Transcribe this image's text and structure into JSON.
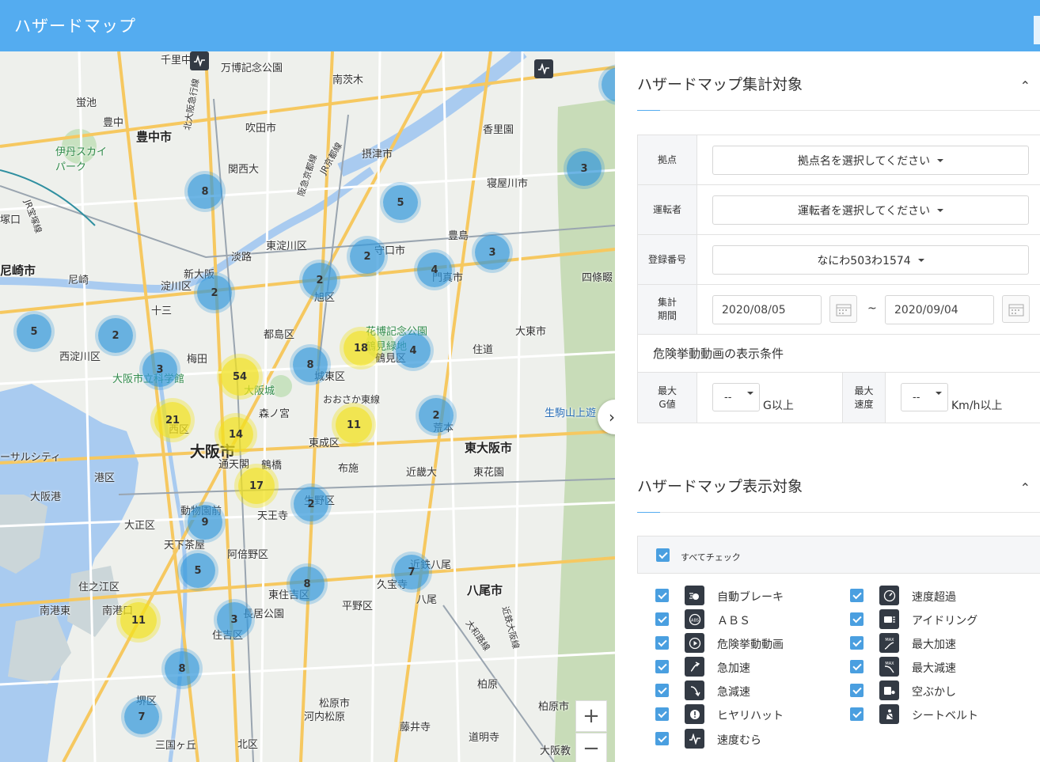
{
  "header": {
    "title": "ハザードマップ"
  },
  "map": {
    "labels": [
      {
        "text": "千里中央",
        "cls": ""
      },
      {
        "text": "万博記念公園",
        "cls": ""
      },
      {
        "text": "南茨木",
        "cls": ""
      },
      {
        "text": "蛍池",
        "cls": ""
      },
      {
        "text": "豊中",
        "cls": ""
      },
      {
        "text": "豊中市",
        "cls": "big"
      },
      {
        "text": "吹田市",
        "cls": ""
      },
      {
        "text": "香里園",
        "cls": ""
      },
      {
        "text": "伊丹スカイパーク",
        "cls": "green"
      },
      {
        "text": "関西大",
        "cls": ""
      },
      {
        "text": "摂津市",
        "cls": ""
      },
      {
        "text": "寝屋川市",
        "cls": ""
      },
      {
        "text": "尼崎市",
        "cls": "big"
      },
      {
        "text": "新大阪",
        "cls": ""
      },
      {
        "text": "淀川区",
        "cls": ""
      },
      {
        "text": "東淀川区",
        "cls": ""
      },
      {
        "text": "淡路",
        "cls": ""
      },
      {
        "text": "守口市",
        "cls": ""
      },
      {
        "text": "豊島",
        "cls": ""
      },
      {
        "text": "門真市",
        "cls": ""
      },
      {
        "text": "四條畷",
        "cls": ""
      },
      {
        "text": "尼崎",
        "cls": ""
      },
      {
        "text": "十三",
        "cls": ""
      },
      {
        "text": "旭区",
        "cls": ""
      },
      {
        "text": "都島区",
        "cls": ""
      },
      {
        "text": "大東市",
        "cls": ""
      },
      {
        "text": "西淀川区",
        "cls": ""
      },
      {
        "text": "梅田",
        "cls": ""
      },
      {
        "text": "花博記念公園 鶴見緑地",
        "cls": "green"
      },
      {
        "text": "住道",
        "cls": ""
      },
      {
        "text": "大阪市立科学館",
        "cls": "green"
      },
      {
        "text": "大阪城",
        "cls": "green"
      },
      {
        "text": "城東区",
        "cls": ""
      },
      {
        "text": "鶴見区",
        "cls": ""
      },
      {
        "text": "おおさか東線",
        "cls": ""
      },
      {
        "text": "生駒山上遊",
        "cls": "blue"
      },
      {
        "text": "西区",
        "cls": ""
      },
      {
        "text": "森ノ宮",
        "cls": ""
      },
      {
        "text": "荒本",
        "cls": ""
      },
      {
        "text": "大阪市",
        "cls": "huge"
      },
      {
        "text": "東成区",
        "cls": ""
      },
      {
        "text": "東大阪市",
        "cls": "big"
      },
      {
        "text": "ーサルシティ",
        "cls": ""
      },
      {
        "text": "通天閣",
        "cls": ""
      },
      {
        "text": "鶴橋",
        "cls": ""
      },
      {
        "text": "布施",
        "cls": ""
      },
      {
        "text": "港区",
        "cls": ""
      },
      {
        "text": "近畿大",
        "cls": ""
      },
      {
        "text": "東花園",
        "cls": ""
      },
      {
        "text": "大阪港",
        "cls": ""
      },
      {
        "text": "生野区",
        "cls": ""
      },
      {
        "text": "動物園前",
        "cls": ""
      },
      {
        "text": "天王寺",
        "cls": ""
      },
      {
        "text": "大正区",
        "cls": ""
      },
      {
        "text": "天下茶屋",
        "cls": ""
      },
      {
        "text": "阿倍野区",
        "cls": ""
      },
      {
        "text": "近鉄八尾",
        "cls": ""
      },
      {
        "text": "住之江区",
        "cls": ""
      },
      {
        "text": "東住吉区",
        "cls": ""
      },
      {
        "text": "久宝寺",
        "cls": ""
      },
      {
        "text": "八尾市",
        "cls": "big"
      },
      {
        "text": "八尾",
        "cls": ""
      },
      {
        "text": "南港東",
        "cls": ""
      },
      {
        "text": "南港口",
        "cls": ""
      },
      {
        "text": "長居公園",
        "cls": ""
      },
      {
        "text": "平野区",
        "cls": ""
      },
      {
        "text": "住吉区",
        "cls": ""
      },
      {
        "text": "大和路線",
        "cls": ""
      },
      {
        "text": "近鉄大阪線",
        "cls": ""
      },
      {
        "text": "柏原",
        "cls": ""
      },
      {
        "text": "松原市",
        "cls": ""
      },
      {
        "text": "河内松原",
        "cls": ""
      },
      {
        "text": "堺区",
        "cls": ""
      },
      {
        "text": "柏原市",
        "cls": ""
      },
      {
        "text": "藤井寺",
        "cls": ""
      },
      {
        "text": "三国ヶ丘",
        "cls": ""
      },
      {
        "text": "北区",
        "cls": ""
      },
      {
        "text": "道明寺",
        "cls": ""
      },
      {
        "text": "大阪教",
        "cls": ""
      },
      {
        "text": "北大阪急行線",
        "cls": ""
      },
      {
        "text": "阪急京都線",
        "cls": ""
      },
      {
        "text": "JR京都線",
        "cls": ""
      },
      {
        "text": "JR宝塚線",
        "cls": ""
      },
      {
        "text": "塚口",
        "cls": ""
      }
    ],
    "clusters": [
      {
        "count": "8",
        "color": "blue"
      },
      {
        "count": "5",
        "color": "blue"
      },
      {
        "count": "3",
        "color": "blue"
      },
      {
        "count": "2",
        "color": "blue"
      },
      {
        "count": "2",
        "color": "blue"
      },
      {
        "count": "4",
        "color": "blue"
      },
      {
        "count": "3",
        "color": "blue"
      },
      {
        "count": "2",
        "color": "blue"
      },
      {
        "count": "5",
        "color": "blue"
      },
      {
        "count": "2",
        "color": "blue"
      },
      {
        "count": "18",
        "color": "yellow"
      },
      {
        "count": "4",
        "color": "blue"
      },
      {
        "count": "3",
        "color": "blue"
      },
      {
        "count": "54",
        "color": "yellow"
      },
      {
        "count": "8",
        "color": "blue"
      },
      {
        "count": "21",
        "color": "yellow"
      },
      {
        "count": "14",
        "color": "yellow"
      },
      {
        "count": "11",
        "color": "yellow"
      },
      {
        "count": "2",
        "color": "blue"
      },
      {
        "count": "17",
        "color": "yellow"
      },
      {
        "count": "2",
        "color": "blue"
      },
      {
        "count": "9",
        "color": "blue"
      },
      {
        "count": "5",
        "color": "blue"
      },
      {
        "count": "8",
        "color": "blue"
      },
      {
        "count": "7",
        "color": "blue"
      },
      {
        "count": "11",
        "color": "yellow"
      },
      {
        "count": "3",
        "color": "blue"
      },
      {
        "count": "8",
        "color": "blue"
      },
      {
        "count": "7",
        "color": "blue"
      }
    ],
    "zoom_in": "+",
    "zoom_out": "−",
    "collapse": "›"
  },
  "panel": {
    "section1_title": "ハザードマップ集計対象",
    "section2_title": "ハザードマップ表示対象",
    "chevron": "⌃",
    "base_label": "拠点",
    "base_value": "拠点名を選択してください",
    "driver_label": "運転者",
    "driver_value": "運転者を選択してください",
    "plate_label": "登録番号",
    "plate_value": "なにわ503わ1574",
    "period_label_1": "集計",
    "period_label_2": "期間",
    "date_from": "2020/08/05",
    "date_to": "2020/09/04",
    "tilde": "~",
    "video_cond": "危険挙動動画の表示条件",
    "maxg_label_1": "最大",
    "maxg_label_2": "G値",
    "maxg_value": "--",
    "maxg_unit": "G以上",
    "maxspeed_label_1": "最大",
    "maxspeed_label_2": "速度",
    "maxspeed_value": "--",
    "maxspeed_unit": "Km/h以上",
    "check_all": "すべてチェック",
    "options_left": [
      {
        "label": "自動ブレーキ",
        "icon": "auto-brake-icon"
      },
      {
        "label": "ＡＢＳ",
        "icon": "abs-icon"
      },
      {
        "label": "危険挙動動画",
        "icon": "play-icon"
      },
      {
        "label": "急加速",
        "icon": "sudden-accel-icon"
      },
      {
        "label": "急減速",
        "icon": "sudden-decel-icon"
      },
      {
        "label": "ヒヤリハット",
        "icon": "near-miss-icon"
      },
      {
        "label": "速度むら",
        "icon": "speed-variation-icon"
      }
    ],
    "options_right": [
      {
        "label": "速度超過",
        "icon": "speeding-icon"
      },
      {
        "label": "アイドリング",
        "icon": "idling-icon"
      },
      {
        "label": "最大加速",
        "icon": "max-accel-icon"
      },
      {
        "label": "最大減速",
        "icon": "max-decel-icon"
      },
      {
        "label": "空ぶかし",
        "icon": "revving-icon"
      },
      {
        "label": "シートベルト",
        "icon": "seatbelt-icon"
      }
    ]
  }
}
